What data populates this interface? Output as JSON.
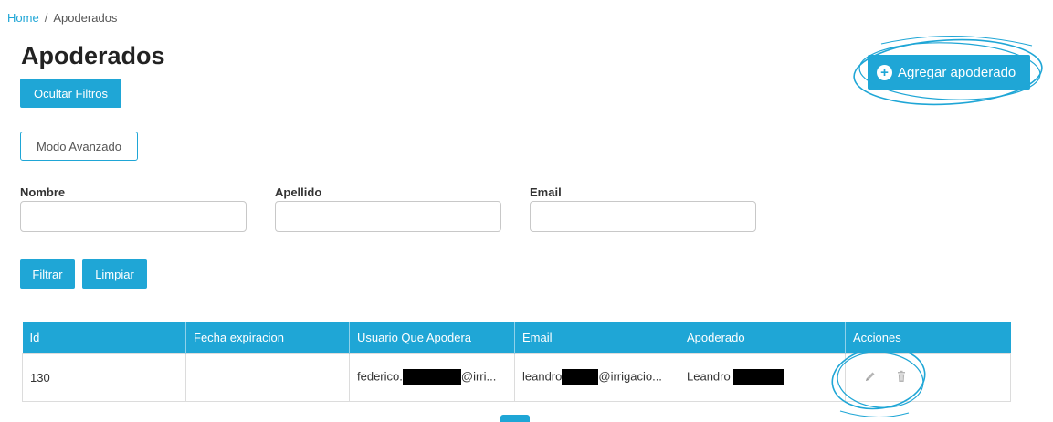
{
  "breadcrumb": {
    "home": "Home",
    "separator": "/",
    "current": "Apoderados"
  },
  "page": {
    "title": "Apoderados"
  },
  "buttons": {
    "hide_filters": "Ocultar Filtros",
    "advanced_mode": "Modo Avanzado",
    "add": "Agregar apoderado",
    "filter": "Filtrar",
    "clear": "Limpiar"
  },
  "filters": {
    "nombre": {
      "label": "Nombre",
      "value": ""
    },
    "apellido": {
      "label": "Apellido",
      "value": ""
    },
    "email": {
      "label": "Email",
      "value": ""
    }
  },
  "table": {
    "columns": [
      "Id",
      "Fecha expiracion",
      "Usuario Que Apodera",
      "Email",
      "Apoderado",
      "Acciones"
    ],
    "rows": [
      {
        "id": "130",
        "fecha": "",
        "usuario_prefix": "federico.",
        "usuario_suffix": "@irri...",
        "email_prefix": "leandro",
        "email_suffix": "@irrigacio...",
        "apoderado": "Leandro"
      }
    ]
  },
  "icons": {
    "add": "plus-circle-icon",
    "edit": "pencil-icon",
    "delete": "trash-icon"
  },
  "colors": {
    "primary": "#1fa6d6",
    "annotation": "#1fa6d6",
    "redaction": "#000000"
  }
}
